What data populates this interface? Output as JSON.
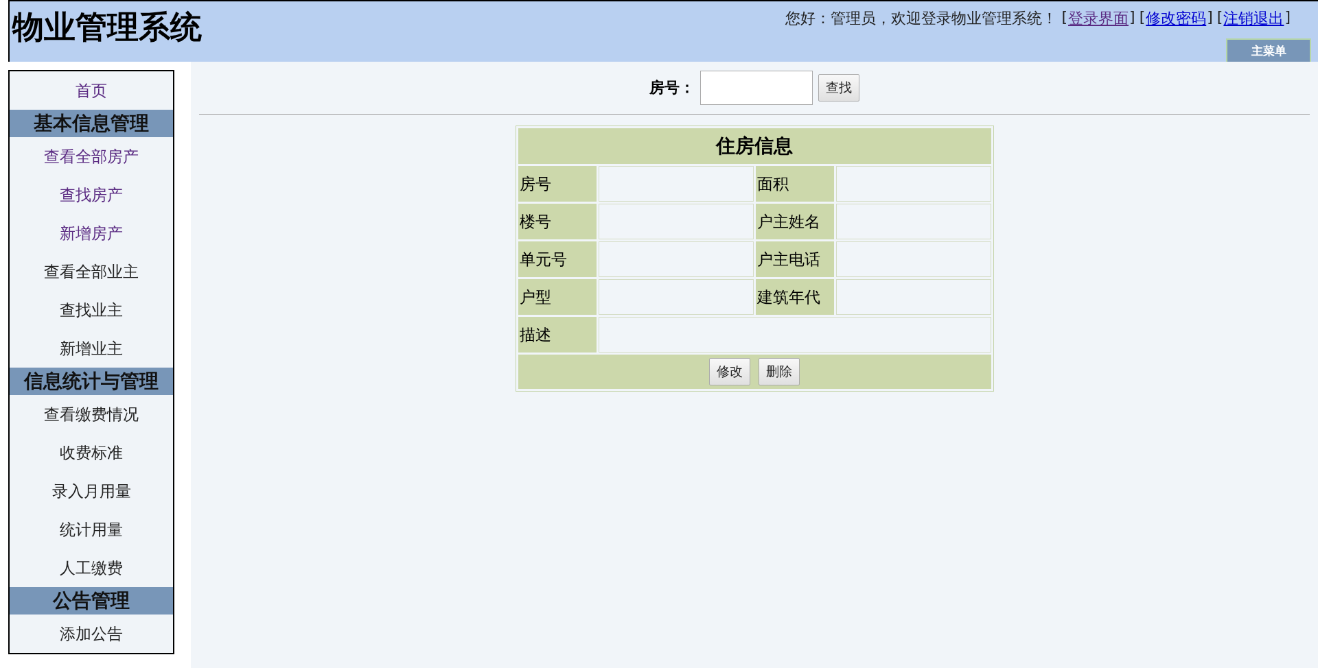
{
  "header": {
    "title": "物业管理系统",
    "greeting": "您好：管理员，欢迎登录物业管理系统！",
    "links": [
      {
        "open": "[",
        "label": "登录界面",
        "close": "]",
        "visited": true
      },
      {
        "open": "[",
        "label": "修改密码",
        "close": "]",
        "visited": false
      },
      {
        "open": "[",
        "label": "注销退出",
        "close": "]",
        "visited": false
      }
    ],
    "main_menu_button": "主菜单"
  },
  "sidebar": {
    "sections": [
      {
        "kind": "link",
        "label": "首页",
        "visited": true
      },
      {
        "kind": "heading",
        "label": "基本信息管理"
      },
      {
        "kind": "link",
        "label": "查看全部房产",
        "visited": true
      },
      {
        "kind": "link",
        "label": "查找房产",
        "visited": true
      },
      {
        "kind": "link",
        "label": "新增房产",
        "visited": true
      },
      {
        "kind": "link",
        "label": "查看全部业主",
        "visited": false
      },
      {
        "kind": "link",
        "label": "查找业主",
        "visited": false
      },
      {
        "kind": "link",
        "label": "新增业主",
        "visited": false
      },
      {
        "kind": "heading",
        "label": "信息统计与管理"
      },
      {
        "kind": "link",
        "label": "查看缴费情况",
        "visited": false
      },
      {
        "kind": "link",
        "label": "收费标准",
        "visited": false
      },
      {
        "kind": "link",
        "label": "录入月用量",
        "visited": false
      },
      {
        "kind": "link",
        "label": "统计用量",
        "visited": false
      },
      {
        "kind": "link",
        "label": "人工缴费",
        "visited": false
      },
      {
        "kind": "heading",
        "label": "公告管理"
      },
      {
        "kind": "link",
        "label": "添加公告",
        "visited": false
      }
    ]
  },
  "search": {
    "label": "房号：",
    "button": "查找"
  },
  "table": {
    "title": "住房信息",
    "rows": [
      [
        "房号",
        "面积"
      ],
      [
        "楼号",
        "户主姓名"
      ],
      [
        "单元号",
        "户主电话"
      ],
      [
        "户型",
        "建筑年代"
      ]
    ],
    "description_label": "描述",
    "buttons": [
      "修改",
      "删除"
    ]
  }
}
